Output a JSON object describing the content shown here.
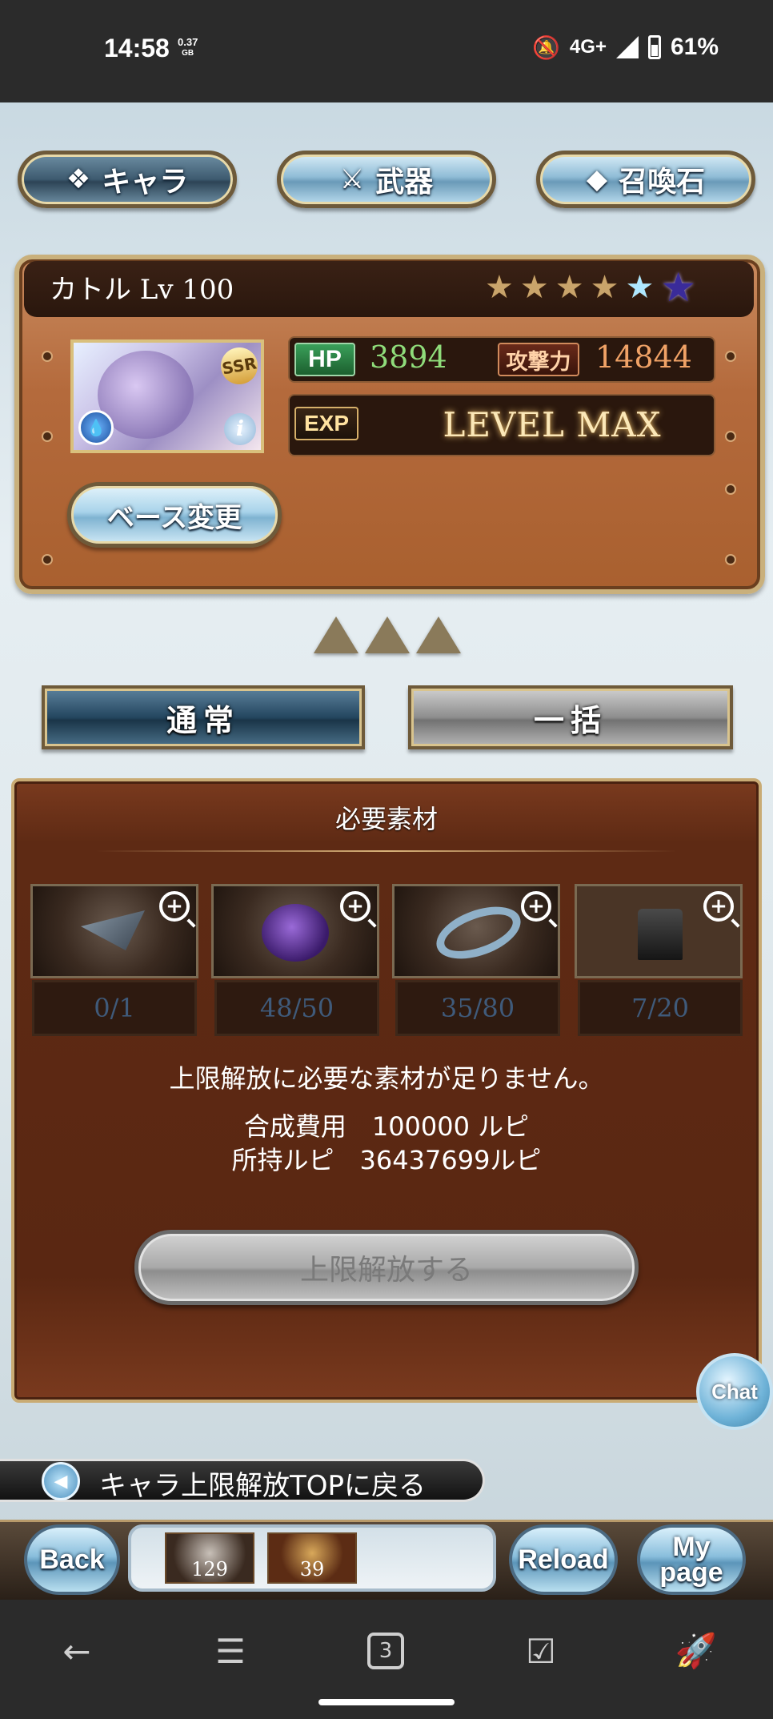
{
  "status_bar": {
    "time": "14:58",
    "data_speed_value": "0.37",
    "data_speed_unit": "GB",
    "network": "4G+",
    "battery": "61%"
  },
  "top_tabs": [
    {
      "label": "キャラ",
      "icon": "chara-icon"
    },
    {
      "label": "武器",
      "icon": "weapon-icon"
    },
    {
      "label": "召喚石",
      "icon": "summon-stone-icon"
    }
  ],
  "character": {
    "name_level": "カトル Lv 100",
    "stars_filled": 4,
    "stars_blue": 1,
    "stars_purple": 1,
    "rarity": "SSR",
    "element": "water",
    "hp_label": "HP",
    "hp_value": "3894",
    "atk_label": "攻撃力",
    "atk_value": "14844",
    "exp_label": "EXP",
    "exp_value": "LEVEL MAX",
    "base_change_label": "ベース変更"
  },
  "mode_tabs": {
    "normal": "通常",
    "bulk": "一括"
  },
  "materials": {
    "title": "必要素材",
    "items": [
      {
        "count": "0/1"
      },
      {
        "count": "48/50"
      },
      {
        "count": "35/80"
      },
      {
        "count": "7/20"
      }
    ],
    "message": "上限解放に必要な素材が足りません。",
    "cost_line": "合成費用　100000 ルピ",
    "owned_line": "所持ルピ　36437699ルピ",
    "unlock_button": "上限解放する"
  },
  "chat_label": "Chat",
  "back_to_top": "キャラ上限解放TOPに戻る",
  "bottom_bar": {
    "back_label": "Back",
    "reload_label": "Reload",
    "mypage_line1": "My",
    "mypage_line2": "page",
    "inventory": [
      {
        "count": "129"
      },
      {
        "count": "39"
      }
    ]
  },
  "nav": {
    "recent_count": "3"
  },
  "colors": {
    "hp": "#8fdc7a",
    "atk": "#f0a266",
    "material_count": "#3f5a7a",
    "panel_brown": "#5a2712"
  }
}
